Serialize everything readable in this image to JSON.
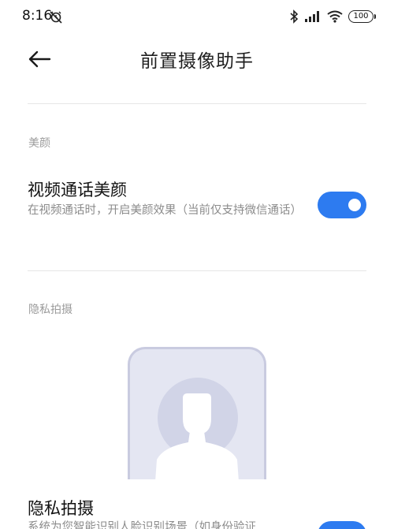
{
  "status_bar": {
    "time": "8:16",
    "battery": "100",
    "icons": [
      "alarm-muted-icon",
      "bluetooth-icon",
      "signal-icon",
      "wifi-icon",
      "battery-icon"
    ]
  },
  "header": {
    "back_icon": "arrow-left-icon",
    "title": "前置摄像助手"
  },
  "sections": {
    "beauty": {
      "label": "美颜",
      "setting": {
        "title": "视频通话美颜",
        "description": "在视频通话时，开启美颜效果（当前仅支持微信通话）",
        "enabled": true
      }
    },
    "privacy": {
      "label": "隐私拍摄",
      "preview_icon": "person-silhouette-icon",
      "setting": {
        "title": "隐私拍摄",
        "description": "系统为您智能识别人脸识别场景（如身份验证",
        "enabled": true
      }
    }
  },
  "colors": {
    "accent": "#2d7bf0",
    "text_primary": "#111111",
    "text_secondary": "#8c8c8c",
    "section_label": "#9b9b9b",
    "preview_bg": "#e4e6f2"
  }
}
